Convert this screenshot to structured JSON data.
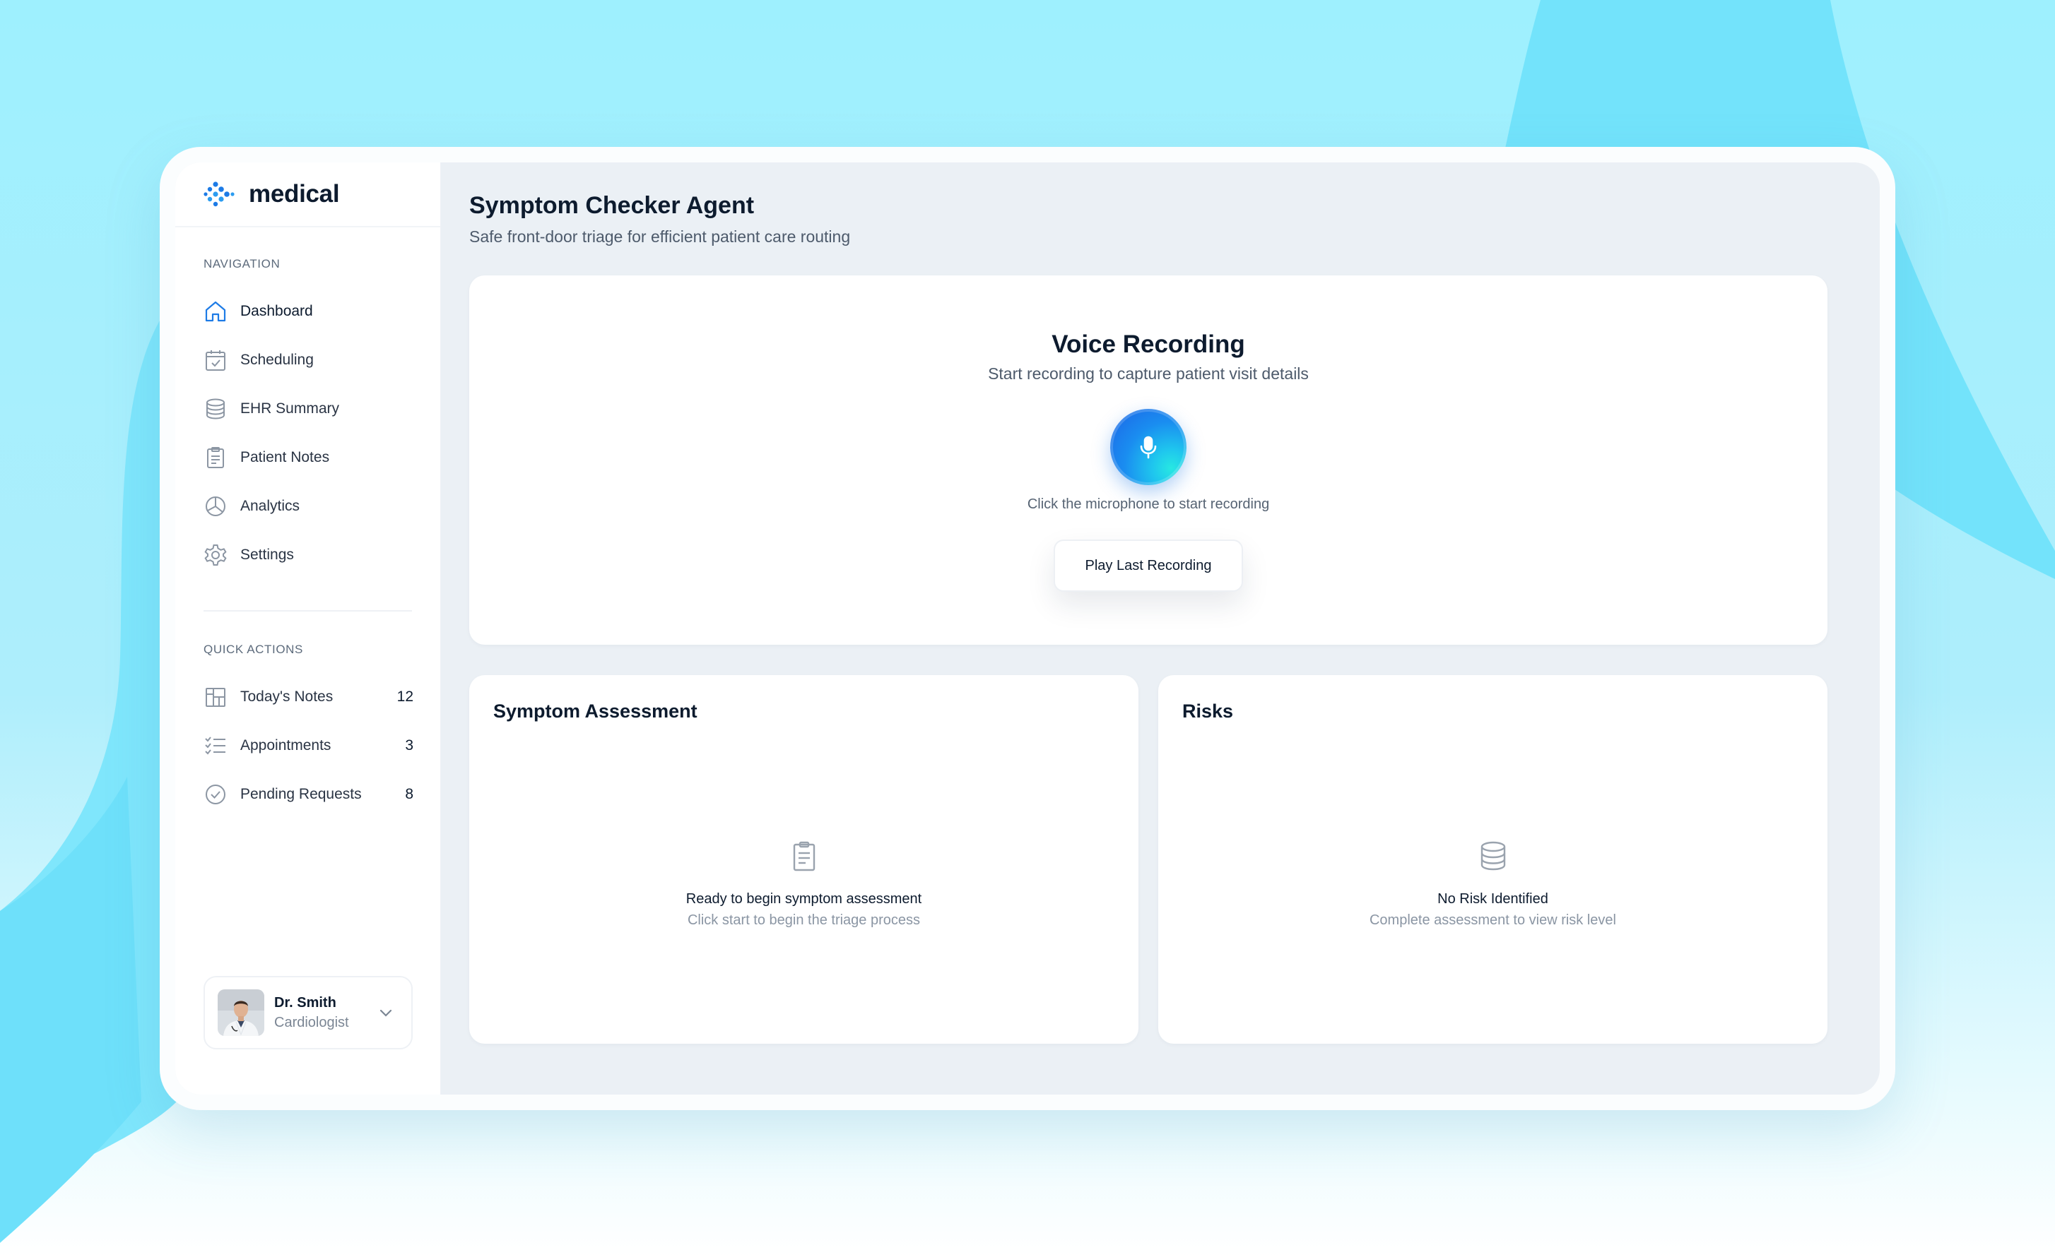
{
  "brand": {
    "name": "medical",
    "logo_icon": "dots-logo-icon",
    "accent": "#1d7be6"
  },
  "sidebar": {
    "navigation_label": "NAVIGATION",
    "items": [
      {
        "label": "Dashboard",
        "icon": "home-icon",
        "active": true
      },
      {
        "label": "Scheduling",
        "icon": "calendar-check-icon"
      },
      {
        "label": "EHR Summary",
        "icon": "database-icon"
      },
      {
        "label": "Patient Notes",
        "icon": "clipboard-icon"
      },
      {
        "label": "Analytics",
        "icon": "pie-chart-icon"
      },
      {
        "label": "Settings",
        "icon": "gear-icon"
      }
    ],
    "quick_actions_label": "QUICK ACTIONS",
    "quick_actions": [
      {
        "label": "Today's Notes",
        "count": "12",
        "icon": "layout-icon"
      },
      {
        "label": "Appointments",
        "count": "3",
        "icon": "checklist-icon"
      },
      {
        "label": "Pending Requests",
        "count": "8",
        "icon": "check-circle-icon"
      }
    ]
  },
  "user": {
    "name": "Dr. Smith",
    "role": "Cardiologist"
  },
  "header": {
    "title": "Symptom Checker Agent",
    "subtitle": "Safe front-door triage for efficient patient care routing"
  },
  "voice": {
    "title": "Voice Recording",
    "subtitle": "Start recording to capture patient visit details",
    "hint": "Click the microphone to start recording",
    "play_label": "Play Last Recording"
  },
  "assessment": {
    "title": "Symptom Assessment",
    "empty_title": "Ready to begin symptom assessment",
    "empty_sub": "Click start to begin the triage process"
  },
  "risks": {
    "title": "Risks",
    "empty_title": "No Risk Identified",
    "empty_sub": "Complete assessment to view risk level"
  }
}
